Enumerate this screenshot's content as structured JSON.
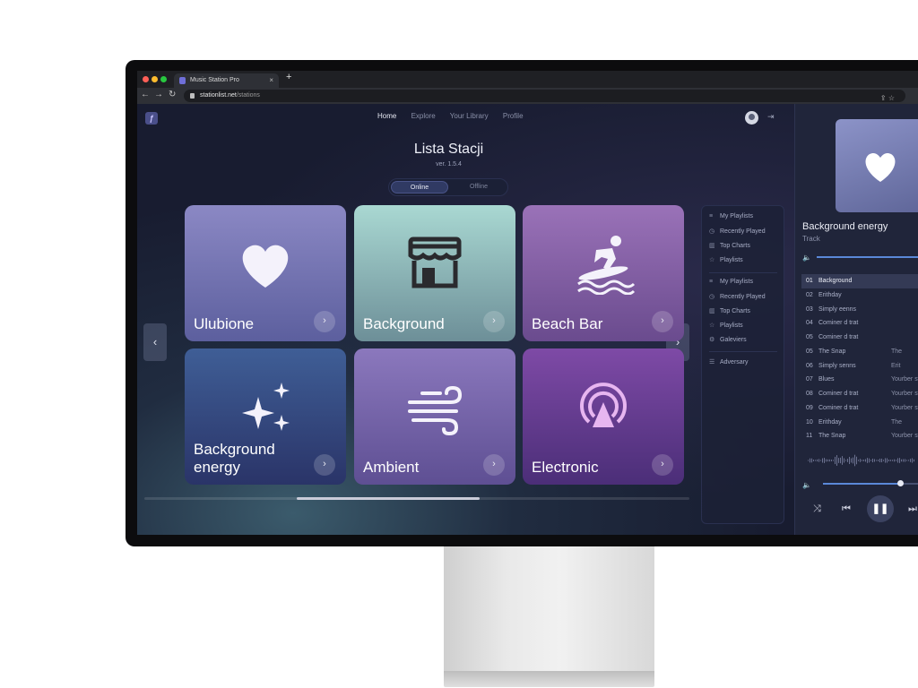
{
  "browser": {
    "tab_title": "Music Station Pro",
    "new_tab": "+",
    "close": "×",
    "url_host": "stationlist.net",
    "url_path": "/stations",
    "back": "←",
    "forward": "→",
    "reload": "↻",
    "url_actions": "⇪  ☆"
  },
  "nav": {
    "logo": "ƒ",
    "items": [
      "Home",
      "Explore",
      "Your Library",
      "Profile"
    ],
    "active": "Home",
    "logout_icon": "⇥"
  },
  "header": {
    "title": "Lista Stacji",
    "version": "ver. 1.5.4"
  },
  "segment": {
    "online": "Online",
    "offline": "Offline",
    "selected": "Online"
  },
  "carousel": {
    "prev": "‹",
    "next": "›",
    "cards": [
      {
        "label": "Ulubione",
        "icon": "heart-icon",
        "colors": [
          "#8b88c4",
          "#5c5f9e"
        ]
      },
      {
        "label": "Background",
        "icon": "store-icon",
        "colors": [
          "#a9d8d2",
          "#6d8f98"
        ]
      },
      {
        "label": "Beach Bar",
        "icon": "surfer-icon",
        "colors": [
          "#9a72b8",
          "#6a4b8e"
        ]
      },
      {
        "label": "Background energy",
        "icon": "sparkles-icon",
        "colors": [
          "#3f5e96",
          "#2a3468"
        ]
      },
      {
        "label": "Ambient",
        "icon": "wind-icon",
        "colors": [
          "#8b78bd",
          "#5e4f93"
        ]
      },
      {
        "label": "Electronic",
        "icon": "broadcast-icon",
        "colors": [
          "#7e4aa6",
          "#4b2e78"
        ]
      }
    ],
    "card_arrow": "›",
    "scroll_position": 0.42
  },
  "side_menu": {
    "items": [
      {
        "label": "My Playlists",
        "icon": "playlist-icon"
      },
      {
        "label": "Recently Played",
        "icon": "history-icon"
      },
      {
        "label": "Top Charts",
        "icon": "chart-icon"
      },
      {
        "label": "Playlists",
        "icon": "star-icon"
      },
      {
        "label": "My Playlists",
        "icon": "playlist-icon"
      },
      {
        "label": "Recently Played",
        "icon": "history-icon"
      },
      {
        "label": "Top Charts",
        "icon": "chart-icon"
      },
      {
        "label": "Playlists",
        "icon": "star-icon"
      },
      {
        "label": "Galeviers",
        "icon": "gear-icon"
      },
      {
        "label": "Adversary",
        "icon": "list-icon"
      }
    ]
  },
  "player": {
    "now_playing": "Background energy",
    "subtitle": "Track",
    "volume_icon": "🔈",
    "tracks": [
      {
        "num": "01",
        "title": "Background",
        "artist": ""
      },
      {
        "num": "02",
        "title": "Erithday",
        "artist": ""
      },
      {
        "num": "03",
        "title": "Simply eenns",
        "artist": ""
      },
      {
        "num": "04",
        "title": "Cominer d trat",
        "artist": ""
      },
      {
        "num": "05",
        "title": "Cominer d trat",
        "artist": ""
      },
      {
        "num": "05",
        "title": "The Snap",
        "artist": "The"
      },
      {
        "num": "06",
        "title": "Simply senns",
        "artist": "Erit"
      },
      {
        "num": "07",
        "title": "Blues",
        "artist": "Yourber sw"
      },
      {
        "num": "08",
        "title": "Cominer d trat",
        "artist": "Yourber sw"
      },
      {
        "num": "09",
        "title": "Cominer d trat",
        "artist": "Yourber sw"
      },
      {
        "num": "10",
        "title": "Erithday",
        "artist": "The"
      },
      {
        "num": "11",
        "title": "The Snap",
        "artist": "Yourber sw"
      }
    ],
    "selected_track": 0,
    "progress": 0.8,
    "controls": {
      "shuffle": "⤨",
      "prev": "⏮",
      "play_pause": "❚❚",
      "next": "⏭"
    }
  },
  "colors": {
    "accent": "#5a88d8",
    "app_bg": "#161b2d"
  }
}
